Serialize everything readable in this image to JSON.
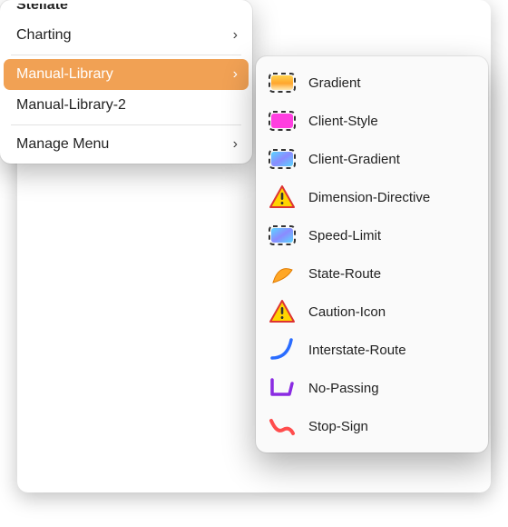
{
  "main_menu": {
    "truncated_top": "Stellate",
    "items": [
      {
        "label": "Charting",
        "has_submenu": true,
        "selected": false
      },
      {
        "separator": true
      },
      {
        "label": "Manual-Library",
        "has_submenu": true,
        "selected": true
      },
      {
        "label": "Manual-Library-2",
        "has_submenu": false,
        "selected": false
      },
      {
        "separator": true
      },
      {
        "label": "Manage Menu",
        "has_submenu": true,
        "selected": false
      }
    ]
  },
  "submenu": {
    "items": [
      {
        "label": "Gradient",
        "icon": "swatch-gradient-orange"
      },
      {
        "label": "Client-Style",
        "icon": "swatch-magenta"
      },
      {
        "label": "Client-Gradient",
        "icon": "swatch-gradient-cyan"
      },
      {
        "label": "Dimension-Directive",
        "icon": "warning-triangle"
      },
      {
        "label": "Speed-Limit",
        "icon": "swatch-gradient-cyan"
      },
      {
        "label": "State-Route",
        "icon": "shape-curved-triangle"
      },
      {
        "label": "Caution-Icon",
        "icon": "warning-triangle"
      },
      {
        "label": "Interstate-Route",
        "icon": "curve-blue"
      },
      {
        "label": "No-Passing",
        "icon": "polyline-purple"
      },
      {
        "label": "Stop-Sign",
        "icon": "squiggle-red"
      }
    ]
  },
  "glyphs": {
    "chevron_right": "›"
  }
}
